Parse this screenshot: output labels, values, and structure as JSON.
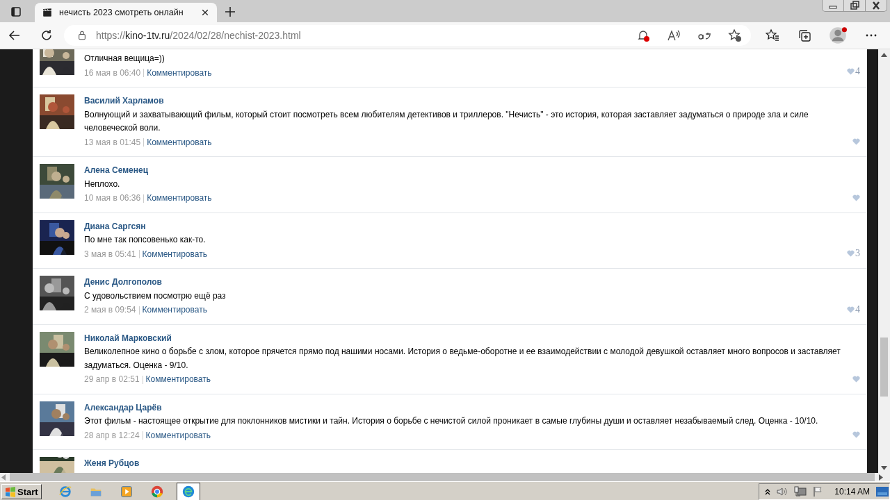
{
  "browser": {
    "tabs": [
      {
        "title": "нечисть 2023 смотреть онлайн",
        "selected": true
      }
    ],
    "url_scheme": "https://",
    "url_host": "kino-1tv.ru",
    "url_path": "/2024/02/28/nechist-2023.html"
  },
  "comments": [
    {
      "kind": "partial",
      "text": "Отличная вещица=))",
      "date": "16 мая в 06:40",
      "reply": "Комментировать",
      "likes": "4"
    },
    {
      "kind": "full",
      "author": "Василий Харламов",
      "text": "Волнующий и захватывающий фильм, который стоит посмотреть всем любителям детективов и триллеров. \"Нечисть\" - это история, которая заставляет задуматься о природе зла и силе человеческой воли.",
      "date": "13 мая в 01:45",
      "reply": "Комментировать"
    },
    {
      "kind": "full",
      "author": "Алена Семенец",
      "text": "Неплохо.",
      "date": "10 мая в 06:36",
      "reply": "Комментировать"
    },
    {
      "kind": "full",
      "author": "Диана Саргсян",
      "text": "По мне так попсовенько как-то.",
      "date": "3 мая в 05:41",
      "reply": "Комментировать",
      "likes": "3"
    },
    {
      "kind": "full",
      "author": "Денис Долгополов",
      "text": "С удовольствием посмотрю ещё раз",
      "date": "2 мая в 09:54",
      "reply": "Комментировать",
      "likes": "4"
    },
    {
      "kind": "full",
      "author": "Николай Марковский",
      "text": "Великолепное кино о борьбе с злом, которое прячется прямо под нашими носами. История о ведьме-оборотне и ее взаимодействии с молодой девушкой оставляет много вопросов и заставляет задуматься. Оценка - 9/10.",
      "date": "29 апр в 02:51",
      "reply": "Комментировать"
    },
    {
      "kind": "full",
      "author": "Александар Царёв",
      "text": "Этот фильм - настоящее открытие для поклонников мистики и тайн. История о борьбе с нечистой силой проникает в самые глубины души и оставляет незабываемый след. Оценка - 10/10.",
      "date": "28 апр в 12:24",
      "reply": "Комментировать"
    },
    {
      "kind": "cut",
      "author": "Женя Рубцов"
    }
  ],
  "taskbar": {
    "start": "Start",
    "apps": [
      {
        "kind": "ie",
        "selected": false
      },
      {
        "kind": "folder",
        "selected": false
      },
      {
        "kind": "media",
        "selected": false
      },
      {
        "kind": "chrome",
        "selected": false
      },
      {
        "kind": "edge",
        "selected": true
      }
    ],
    "time": "10:14 AM"
  }
}
